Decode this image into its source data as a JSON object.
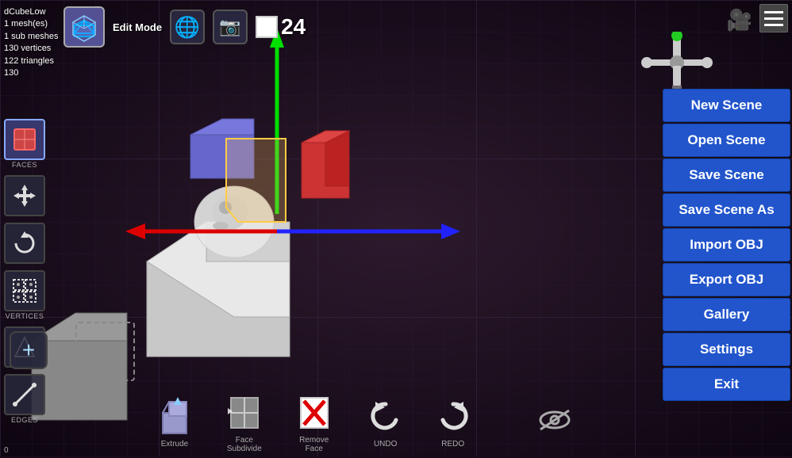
{
  "info": {
    "object_name": "dCubeLow",
    "meshes": "1 mesh(es)",
    "sub_meshes": "1 sub meshes",
    "vertices": "130 vertices",
    "triangles": "122 triangles",
    "mode_value": "130"
  },
  "top_toolbar": {
    "edit_mode_label": "Edit Mode",
    "frame_number": "24"
  },
  "left_toolbar": {
    "faces_label": "FACES",
    "vertices_label": "VERTICES",
    "edges_label": "EDGES"
  },
  "bottom_toolbar": {
    "extrude_label": "Extrude",
    "face_subdivide_label": "Face Subdivide",
    "remove_face_label": "Remove Face",
    "undo_label": "UNDO",
    "redo_label": "REDO"
  },
  "right_menu": {
    "new_scene": "New Scene",
    "open_scene": "Open Scene",
    "save_scene": "Save Scene",
    "save_scene_as": "Save Scene As",
    "import_obj": "Import OBJ",
    "export_obj": "Export OBJ",
    "gallery": "Gallery",
    "settings": "Settings",
    "exit": "Exit"
  },
  "gizmo": {
    "label": "navigation gizmo"
  },
  "colors": {
    "menu_bg": "#2255cc",
    "menu_border": "#1144aa",
    "axis_green": "#00cc00",
    "axis_red": "#cc0000",
    "axis_blue": "#0000ee"
  },
  "bottom_coord": "0"
}
